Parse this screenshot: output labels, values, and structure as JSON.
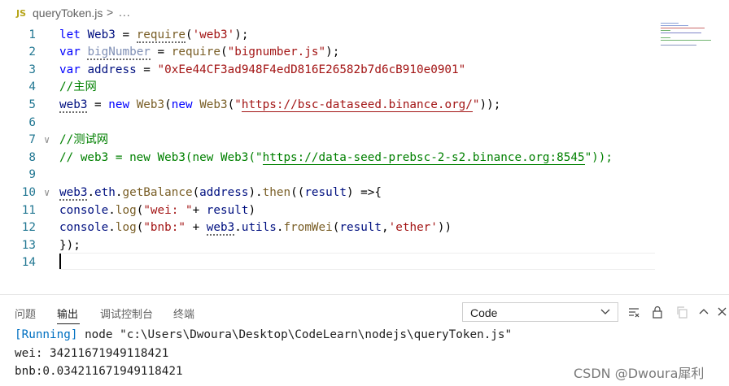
{
  "breadcrumb": {
    "lang_badge": "JS",
    "file": "queryToken.js",
    "separator": ">",
    "more": "..."
  },
  "editor": {
    "lines": [
      {
        "num": "1",
        "tokens": [
          [
            "kw",
            "let"
          ],
          [
            "plain",
            " "
          ],
          [
            "var",
            "Web3"
          ],
          [
            "plain",
            " = "
          ],
          [
            "fn-sq",
            "require"
          ],
          [
            "plain",
            "("
          ],
          [
            "str",
            "'web3'"
          ],
          [
            "plain",
            ");"
          ]
        ]
      },
      {
        "num": "2",
        "tokens": [
          [
            "kw",
            "var"
          ],
          [
            "plain",
            " "
          ],
          [
            "var-unused-sq",
            "bigNumber"
          ],
          [
            "plain",
            " = "
          ],
          [
            "fn",
            "require"
          ],
          [
            "plain",
            "("
          ],
          [
            "str",
            "\"bignumber.js\""
          ],
          [
            "plain",
            ");"
          ]
        ]
      },
      {
        "num": "3",
        "tokens": [
          [
            "kw",
            "var"
          ],
          [
            "plain",
            " "
          ],
          [
            "var",
            "address"
          ],
          [
            "plain",
            " = "
          ],
          [
            "str",
            "\"0xEe44CF3ad948F4edD816E26582b7d6cB910e0901\""
          ]
        ]
      },
      {
        "num": "4",
        "tokens": [
          [
            "cmt",
            "//主网"
          ]
        ]
      },
      {
        "num": "5",
        "tokens": [
          [
            "var-sq",
            "web3"
          ],
          [
            "plain",
            " = "
          ],
          [
            "kw",
            "new"
          ],
          [
            "plain",
            " "
          ],
          [
            "fn",
            "Web3"
          ],
          [
            "plain",
            "("
          ],
          [
            "kw",
            "new"
          ],
          [
            "plain",
            " "
          ],
          [
            "fn",
            "Web3"
          ],
          [
            "plain",
            "("
          ],
          [
            "str",
            "\""
          ],
          [
            "str-ul",
            "https://bsc-dataseed.binance.org/"
          ],
          [
            "str",
            "\""
          ],
          [
            "plain",
            "));"
          ]
        ]
      },
      {
        "num": "6",
        "tokens": []
      },
      {
        "num": "7",
        "fold": "∨",
        "tokens": [
          [
            "cmt",
            "//测试网"
          ]
        ]
      },
      {
        "num": "8",
        "tokens": [
          [
            "cmt",
            "// web3 = new Web3(new Web3(\""
          ],
          [
            "cmt-ul",
            "https://data-seed-prebsc-2-s2.binance.org:8545"
          ],
          [
            "cmt",
            "\"));"
          ]
        ]
      },
      {
        "num": "9",
        "tokens": []
      },
      {
        "num": "10",
        "fold": "∨",
        "tokens": [
          [
            "var-sq",
            "web3"
          ],
          [
            "plain",
            "."
          ],
          [
            "var",
            "eth"
          ],
          [
            "plain",
            "."
          ],
          [
            "fn",
            "getBalance"
          ],
          [
            "plain",
            "("
          ],
          [
            "var",
            "address"
          ],
          [
            "plain",
            ")."
          ],
          [
            "fn",
            "then"
          ],
          [
            "plain",
            "(("
          ],
          [
            "var",
            "result"
          ],
          [
            "plain",
            ") =>{"
          ]
        ]
      },
      {
        "num": "11",
        "tokens": [
          [
            "var",
            "console"
          ],
          [
            "plain",
            "."
          ],
          [
            "fn",
            "log"
          ],
          [
            "plain",
            "("
          ],
          [
            "str",
            "\"wei: \""
          ],
          [
            "plain",
            "+ "
          ],
          [
            "var",
            "result"
          ],
          [
            "plain",
            ")"
          ]
        ]
      },
      {
        "num": "12",
        "tokens": [
          [
            "var",
            "console"
          ],
          [
            "plain",
            "."
          ],
          [
            "fn",
            "log"
          ],
          [
            "plain",
            "("
          ],
          [
            "str",
            "\"bnb:\""
          ],
          [
            "plain",
            " + "
          ],
          [
            "var-sq",
            "web3"
          ],
          [
            "plain",
            "."
          ],
          [
            "var",
            "utils"
          ],
          [
            "plain",
            "."
          ],
          [
            "fn",
            "fromWei"
          ],
          [
            "plain",
            "("
          ],
          [
            "var",
            "result"
          ],
          [
            "plain",
            ","
          ],
          [
            "str",
            "'ether'"
          ],
          [
            "plain",
            "))"
          ]
        ]
      },
      {
        "num": "13",
        "tokens": [
          [
            "plain",
            "});"
          ]
        ]
      },
      {
        "num": "14",
        "tokens": []
      }
    ]
  },
  "panel": {
    "tabs": [
      {
        "label": "问题",
        "active": false
      },
      {
        "label": "输出",
        "active": true
      },
      {
        "label": "调试控制台",
        "active": false
      },
      {
        "label": "终端",
        "active": false
      }
    ],
    "output_channel": "Code",
    "output": {
      "running_tag": "[Running]",
      "command": " node \"c:\\Users\\Dwoura\\Desktop\\CodeLearn\\nodejs\\queryToken.js\"",
      "line2": "wei: 34211671949118421",
      "line3": "bnb:0.034211671949118421"
    }
  },
  "watermark": "CSDN @Dwoura犀利",
  "colors": {
    "keyword": "#0000ff",
    "variable": "#001080",
    "function": "#795e26",
    "string": "#a31515",
    "comment": "#008000",
    "line_number": "#237893"
  }
}
